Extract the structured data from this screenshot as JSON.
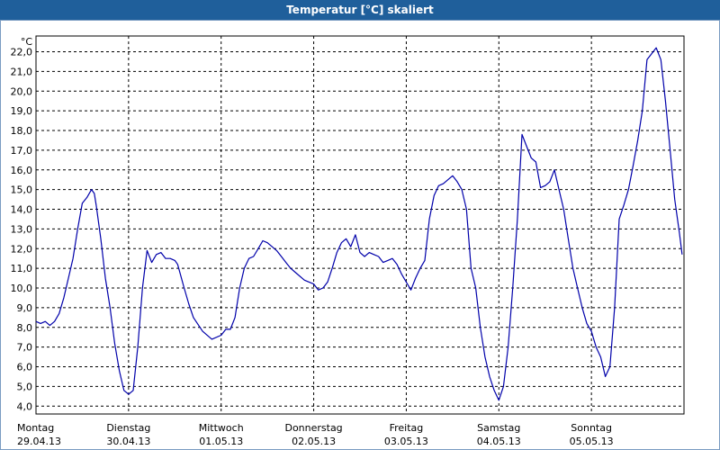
{
  "chart_data": {
    "type": "line",
    "title": "Temperatur [°C] skaliert",
    "ylabel": "°C",
    "xlabel": "",
    "ylim": [
      3.6,
      22.8
    ],
    "yticks": [
      4.0,
      5.0,
      6.0,
      7.0,
      8.0,
      9.0,
      10.0,
      11.0,
      12.0,
      13.0,
      14.0,
      15.0,
      16.0,
      17.0,
      18.0,
      19.0,
      20.0,
      21.0,
      22.0
    ],
    "ytick_labels": [
      "4,0",
      "5,0",
      "6,0",
      "7,0",
      "8,0",
      "9,0",
      "10,0",
      "11,0",
      "12,0",
      "13,0",
      "14,0",
      "15,0",
      "16,0",
      "17,0",
      "18,0",
      "19,0",
      "20,0",
      "21,0",
      "22,0"
    ],
    "xlim": [
      0,
      7
    ],
    "days": [
      {
        "weekday": "Montag",
        "date": "29.04.13"
      },
      {
        "weekday": "Dienstag",
        "date": "30.04.13"
      },
      {
        "weekday": "Mittwoch",
        "date": "01.05.13"
      },
      {
        "weekday": "Donnerstag",
        "date": "02.05.13"
      },
      {
        "weekday": "Freitag",
        "date": "03.05.13"
      },
      {
        "weekday": "Samstag",
        "date": "04.05.13"
      },
      {
        "weekday": "Sonntag",
        "date": "05.05.13"
      }
    ],
    "grid": true,
    "line_color": "#0000aa",
    "series": [
      {
        "x": [
          0,
          0.05,
          0.1,
          0.15,
          0.2,
          0.25,
          0.3,
          0.35,
          0.4,
          0.45,
          0.5,
          0.55,
          0.6,
          0.63,
          0.65,
          0.7,
          0.75,
          0.8,
          0.85,
          0.9,
          0.95,
          1.0,
          1.05,
          1.1,
          1.15,
          1.2,
          1.25,
          1.3,
          1.35,
          1.4,
          1.45,
          1.5,
          1.53,
          1.6,
          1.65,
          1.7,
          1.8,
          1.9,
          2.0,
          2.05,
          2.1,
          2.15,
          2.2,
          2.25,
          2.3,
          2.35,
          2.4,
          2.45,
          2.5,
          2.55,
          2.6,
          2.65,
          2.7,
          2.75,
          2.8,
          2.9,
          3.0,
          3.05,
          3.1,
          3.15,
          3.2,
          3.25,
          3.3,
          3.35,
          3.4,
          3.45,
          3.5,
          3.55,
          3.6,
          3.65,
          3.7,
          3.75,
          3.8,
          3.85,
          3.9,
          3.95,
          4.0,
          4.05,
          4.1,
          4.15,
          4.2,
          4.25,
          4.3,
          4.35,
          4.4,
          4.45,
          4.5,
          4.55,
          4.6,
          4.65,
          4.7,
          4.75,
          4.8,
          4.85,
          4.9,
          4.95,
          5.0,
          5.05,
          5.1,
          5.15,
          5.2,
          5.25,
          5.3,
          5.35,
          5.4,
          5.45,
          5.5,
          5.55,
          5.6,
          5.65,
          5.7,
          5.75,
          5.8,
          5.85,
          5.9,
          5.95,
          6.0,
          6.05,
          6.1,
          6.15,
          6.2,
          6.25,
          6.3,
          6.35,
          6.4,
          6.45,
          6.5,
          6.55,
          6.6,
          6.65,
          6.7,
          6.75,
          6.8,
          6.85,
          6.9,
          6.95,
          6.98
        ],
        "y": [
          8.3,
          8.2,
          8.3,
          8.1,
          8.3,
          8.7,
          9.5,
          10.5,
          11.5,
          13.0,
          14.3,
          14.6,
          15.0,
          14.8,
          14.2,
          12.5,
          10.5,
          9.0,
          7.2,
          5.8,
          4.8,
          4.6,
          4.8,
          7.0,
          10.0,
          11.9,
          11.3,
          11.7,
          11.8,
          11.5,
          11.5,
          11.4,
          11.2,
          10.0,
          9.2,
          8.5,
          7.8,
          7.4,
          7.6,
          7.9,
          7.9,
          8.5,
          10.0,
          11.0,
          11.5,
          11.6,
          12.0,
          12.4,
          12.3,
          12.1,
          11.9,
          11.6,
          11.3,
          11.0,
          10.8,
          10.4,
          10.2,
          9.9,
          10.0,
          10.3,
          11.0,
          11.8,
          12.3,
          12.5,
          12.1,
          12.7,
          11.8,
          11.6,
          11.8,
          11.7,
          11.6,
          11.3,
          11.4,
          11.5,
          11.2,
          10.7,
          10.3,
          9.9,
          10.5,
          11.0,
          11.4,
          13.5,
          14.7,
          15.2,
          15.3,
          15.5,
          15.7,
          15.4,
          15.0,
          14.0,
          11.0,
          10.0,
          8.0,
          6.5,
          5.5,
          4.8,
          4.3,
          5.0,
          7.0,
          10.0,
          13.5,
          17.8,
          17.2,
          16.6,
          16.4,
          15.1,
          15.2,
          15.4,
          16.0,
          15.0,
          14.0,
          12.5,
          11.0,
          10.0,
          9.0,
          8.2,
          7.8,
          7.0,
          6.5,
          5.5,
          6.0,
          9.0,
          13.5,
          14.2,
          15.0,
          16.2,
          17.5,
          19.0,
          21.6,
          21.9,
          22.2,
          21.6,
          19.5,
          17.0,
          14.5,
          12.8,
          11.7
        ]
      }
    ]
  }
}
